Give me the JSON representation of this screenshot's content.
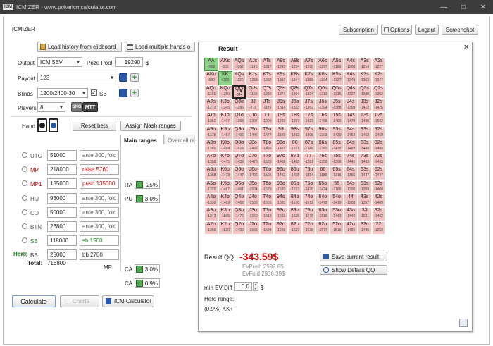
{
  "window": {
    "title": "ICMIZER - www.pokericmcalculator.com",
    "logo": "ICM"
  },
  "app_label": "ICMIZER",
  "toolbar": {
    "subscription": "Subscription",
    "options": "Options",
    "logout": "Logout",
    "screenshot": "Screenshot"
  },
  "left": {
    "load_history": "Load history from clipboard",
    "load_multiple": "Load multiple hands o",
    "output_label": "Output",
    "output_value": "ICM $EV",
    "prize_pool_label": "Prize Pool",
    "prize_pool_value": "19290",
    "prize_pool_unit": "$",
    "payout_label": "Payout",
    "payout_value": "123",
    "blinds_label": "Blinds",
    "blinds_value": "1200/2400-30",
    "sb_label": "SB",
    "players_label": "Players",
    "players_value": "8",
    "sng_label": "SNG",
    "mtt_label": "MTT",
    "hand_label": "Hand",
    "reset_bets": "Reset bets",
    "assign_nash": "Assign Nash ranges",
    "tab_main": "Main ranges",
    "tab_overcall": "Overcall ra",
    "hero_label": "Hero",
    "total_label": "Total:",
    "total_value": "716800",
    "mp_label": "MP",
    "players": [
      {
        "pos": "UTG",
        "stack": "51000",
        "action": "ante 300, fold",
        "pos_color": "#555",
        "action_color": "#555"
      },
      {
        "pos": "MP",
        "stack": "218000",
        "action": "raise 5760",
        "pos_color": "#cc0000",
        "action_color": "#cc0000"
      },
      {
        "pos": "MP1",
        "stack": "135000",
        "action": "push 135000",
        "pos_color": "#cc0000",
        "action_color": "#cc0000"
      },
      {
        "pos": "HIJ",
        "stack": "93000",
        "action": "ante 300, fold",
        "pos_color": "#555",
        "action_color": "#555"
      },
      {
        "pos": "CO",
        "stack": "50000",
        "action": "ante 300, fold",
        "pos_color": "#555",
        "action_color": "#555"
      },
      {
        "pos": "BTN",
        "stack": "26800",
        "action": "ante 300, fold",
        "pos_color": "#555",
        "action_color": "#555"
      },
      {
        "pos": "SB",
        "stack": "118000",
        "action": "sb 1500",
        "pos_color": "#1a7f1a",
        "action_color": "#1a7f1a"
      },
      {
        "pos": "BB",
        "stack": "25000",
        "action": "bb 2700",
        "pos_color": "#333",
        "action_color": "#333"
      }
    ],
    "ranges": [
      {
        "label": "RA",
        "value": "25%"
      },
      {
        "label": "PU",
        "value": "3.0%"
      },
      {
        "label": "CA",
        "value": "3.0%"
      },
      {
        "label": "CA",
        "value": "0.9%"
      }
    ],
    "calculate": "Calculate",
    "charts": "Charts",
    "icm_calculator": "ICM Calculator"
  },
  "result": {
    "title": "Result",
    "result_label": "Result QQ",
    "result_value": "-343.59$",
    "evpush": "EvPush 2592.8$",
    "evfold": "EvFold 2936.39$",
    "save_current": "Save current result",
    "show_details": "Show Details QQ",
    "min_ev_label": "min EV Diff",
    "min_ev_value": "0.0",
    "min_ev_unit": "$",
    "hero_range_label": "Hero range:",
    "hero_range_value": "(0.9%) KK+"
  },
  "grid_colors": {
    "red": "#f4c3c3",
    "green": "#8fd18a",
    "result_red": "#e00000",
    "accent_blue": "#2a5aa8"
  },
  "grid": [
    [
      [
        "AA",
        "+562"
      ],
      [
        "AKs",
        "-565"
      ],
      [
        "AQs",
        "-1067"
      ],
      [
        "AJs",
        "-1145"
      ],
      [
        "ATs",
        "-1217"
      ],
      [
        "A9s",
        "-1243"
      ],
      [
        "A8s",
        "-1234"
      ],
      [
        "A7s",
        "-1228"
      ],
      [
        "A6s",
        "-1237"
      ],
      [
        "A5s",
        "-1199"
      ],
      [
        "A4s",
        "-1200"
      ],
      [
        "A3s",
        "-1214"
      ],
      [
        "A2s",
        "-1227"
      ]
    ],
    [
      [
        "AKo",
        "-680"
      ],
      [
        "KK",
        "+293"
      ],
      [
        "KQs",
        "-1120"
      ],
      [
        "KJs",
        "-1233"
      ],
      [
        "KTs",
        "-1292"
      ],
      [
        "K9s",
        "-1337"
      ],
      [
        "K8s",
        "-1344"
      ],
      [
        "K7s",
        "-1355"
      ],
      [
        "K6s",
        "-1334"
      ],
      [
        "K5s",
        "-1337"
      ],
      [
        "K4s",
        "-1349"
      ],
      [
        "K3s",
        "-1363"
      ],
      [
        "K2s",
        "-1377"
      ]
    ],
    [
      [
        "AQo",
        "-1191"
      ],
      [
        "KQo",
        "-1250"
      ],
      [
        "QQ",
        "-344"
      ],
      [
        "QJs",
        "-1159"
      ],
      [
        "QTs",
        "-1232"
      ],
      [
        "Q9s",
        "-1274"
      ],
      [
        "Q8s",
        "-1304"
      ],
      [
        "Q7s",
        "-1324"
      ],
      [
        "Q6s",
        "-1313"
      ],
      [
        "Q5s",
        "-1316"
      ],
      [
        "Q4s",
        "-1327"
      ],
      [
        "Q3s",
        "-1340"
      ],
      [
        "Q2s",
        "-1352"
      ]
    ],
    [
      [
        "AJo",
        "-1273"
      ],
      [
        "KJo",
        "-1345"
      ],
      [
        "QJo",
        "-1286"
      ],
      [
        "JJ",
        "-716"
      ],
      [
        "JTs",
        "-1176"
      ],
      [
        "J9s",
        "-1314"
      ],
      [
        "J8s",
        "-1333"
      ],
      [
        "J7s",
        "-1362"
      ],
      [
        "J6s",
        "-1394"
      ],
      [
        "J5s",
        "-1388"
      ],
      [
        "J4s",
        "-1399"
      ],
      [
        "J3s",
        "-1412"
      ],
      [
        "J2s",
        "-1425"
      ]
    ],
    [
      [
        "ATo",
        "-1351"
      ],
      [
        "KTo",
        "-1407"
      ],
      [
        "QTo",
        "-1363"
      ],
      [
        "JTo",
        "-1307"
      ],
      [
        "TT",
        "-1009"
      ],
      [
        "T9s",
        "-1293"
      ],
      [
        "T8s",
        "-1397"
      ],
      [
        "T7s",
        "-1423"
      ],
      [
        "T6s",
        "-1465"
      ],
      [
        "T5s",
        "-1466"
      ],
      [
        "T4s",
        "-1479"
      ],
      [
        "T3s",
        "-1490"
      ],
      [
        "T2s",
        "-1502"
      ]
    ],
    [
      [
        "A9o",
        "-1375"
      ],
      [
        "K9o",
        "-1457"
      ],
      [
        "Q9o",
        "-1406"
      ],
      [
        "J9o",
        "-1446"
      ],
      [
        "T9o",
        "-1477"
      ],
      [
        "99",
        "-1199"
      ],
      [
        "98s",
        "-1362"
      ],
      [
        "97s",
        "-1398"
      ],
      [
        "96s",
        "-1393"
      ],
      [
        "95s",
        "-1430"
      ],
      [
        "94s",
        "-1462"
      ],
      [
        "93s",
        "-1463"
      ],
      [
        "92s",
        "-1469"
      ]
    ],
    [
      [
        "A8o",
        "-1365"
      ],
      [
        "K8o",
        "-1484"
      ],
      [
        "Q8o",
        "-1429"
      ],
      [
        "J8o",
        "-1466"
      ],
      [
        "T8o",
        "-1496"
      ],
      [
        "98o",
        "-1493"
      ],
      [
        "88",
        "-1321"
      ],
      [
        "87s",
        "-1346"
      ],
      [
        "86s",
        "-1383"
      ],
      [
        "85s",
        "-1435"
      ],
      [
        "84s",
        "-1488"
      ],
      [
        "83s",
        "-1488"
      ],
      [
        "82s",
        "-1488"
      ]
    ],
    [
      [
        "A7o",
        "-1358"
      ],
      [
        "K7o",
        "-1475"
      ],
      [
        "Q7o",
        "-1459"
      ],
      [
        "J7o",
        "-1478"
      ],
      [
        "T7o",
        "-1525"
      ],
      [
        "97o",
        "-1498"
      ],
      [
        "87o",
        "-1489"
      ],
      [
        "77",
        "-1281"
      ],
      [
        "76s",
        "-1358"
      ],
      [
        "75s",
        "-1398"
      ],
      [
        "74s",
        "-1441"
      ],
      [
        "73s",
        "-1493"
      ],
      [
        "72s",
        "-1493"
      ]
    ],
    [
      [
        "A6o",
        "-1368"
      ],
      [
        "K6o",
        "-1473"
      ],
      [
        "Q6o",
        "-1447"
      ],
      [
        "J6o",
        "-1496"
      ],
      [
        "T6o",
        "-1525"
      ],
      [
        "96o",
        "-1492"
      ],
      [
        "86o",
        "-1498"
      ],
      [
        "76o",
        "-1384"
      ],
      [
        "66",
        "-1186"
      ],
      [
        "65s",
        "-1316"
      ],
      [
        "64s",
        "-1395"
      ],
      [
        "63s",
        "-1447"
      ],
      [
        "62s",
        "-1447"
      ]
    ],
    [
      [
        "A5o",
        "-1325"
      ],
      [
        "K5o",
        "-1467"
      ],
      [
        "Q5o",
        "-1461"
      ],
      [
        "J5o",
        "-1504"
      ],
      [
        "T5o",
        "-1525"
      ],
      [
        "95o",
        "-1520"
      ],
      [
        "85o",
        "-1513"
      ],
      [
        "75o",
        "-1476"
      ],
      [
        "65o",
        "-1424"
      ],
      [
        "55",
        "-1106"
      ],
      [
        "54s",
        "-1306"
      ],
      [
        "53s",
        "-1359"
      ],
      [
        "52s",
        "-1400"
      ]
    ],
    [
      [
        "A4o",
        "-1338"
      ],
      [
        "K4o",
        "-1489"
      ],
      [
        "Q4o",
        "-1462"
      ],
      [
        "J4o",
        "-1536"
      ],
      [
        "T4o",
        "-1605"
      ],
      [
        "94o",
        "-1620"
      ],
      [
        "84o",
        "-1570"
      ],
      [
        "74o",
        "-1512"
      ],
      [
        "64o",
        "-1472"
      ],
      [
        "54o",
        "-1419"
      ],
      [
        "44",
        "-1203"
      ],
      [
        "43s",
        "-1357"
      ],
      [
        "42s",
        "-1409"
      ]
    ],
    [
      [
        "A3o",
        "-1343"
      ],
      [
        "K3o",
        "-1505"
      ],
      [
        "Q3o",
        "-1476"
      ],
      [
        "J3o",
        "-1560"
      ],
      [
        "T3o",
        "-1619"
      ],
      [
        "93o",
        "-1631"
      ],
      [
        "83o",
        "-1626"
      ],
      [
        "73o",
        "-1578"
      ],
      [
        "63o",
        "-1516"
      ],
      [
        "53o",
        "-1443"
      ],
      [
        "43o",
        "-1440"
      ],
      [
        "33",
        "-1231"
      ],
      [
        "32s",
        "-1402"
      ]
    ],
    [
      [
        "A2o",
        "-1356"
      ],
      [
        "K2o",
        "-1520"
      ],
      [
        "Q2o",
        "-1490"
      ],
      [
        "J2o",
        "-1565"
      ],
      [
        "T2o",
        "-1634"
      ],
      [
        "92o",
        "-1656"
      ],
      [
        "82o",
        "-1627"
      ],
      [
        "72o",
        "-1638"
      ],
      [
        "62o",
        "-1577"
      ],
      [
        "52o",
        "-1516"
      ],
      [
        "42o",
        "-1455"
      ],
      [
        "32o",
        "-1485"
      ],
      [
        "22",
        "-1259"
      ]
    ]
  ]
}
